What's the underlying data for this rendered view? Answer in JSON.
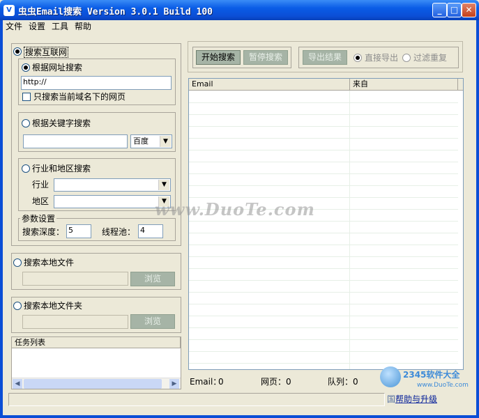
{
  "window": {
    "title": "虫虫Email搜索 Version 3.0.1 Build 100",
    "icon_label": "V",
    "minimize": "_",
    "maximize": "□",
    "close": "✕"
  },
  "menu": [
    "文件",
    "设置",
    "工具",
    "帮助"
  ],
  "search_internet": {
    "label": "搜索互联网",
    "by_url": {
      "label": "根据网址搜索",
      "url_value": "http://",
      "only_domain_label": "只搜索当前域名下的网页"
    },
    "by_keyword": {
      "label": "根据关键字搜索",
      "keyword_value": "",
      "engine": "百度"
    },
    "by_industry": {
      "label": "行业和地区搜索",
      "industry_label": "行业",
      "region_label": "地区"
    },
    "params": {
      "title": "参数设置",
      "depth_label": "搜索深度：",
      "depth_value": "5",
      "threads_label": "线程池：",
      "threads_value": "4"
    }
  },
  "local_file": {
    "label": "搜索本地文件",
    "browse": "浏览"
  },
  "local_folder": {
    "label": "搜索本地文件夹",
    "browse": "浏览"
  },
  "task_list": {
    "header": "任务列表"
  },
  "toolbar": {
    "start": "开始搜索",
    "pause": "暂停搜索",
    "export": "导出结果",
    "direct_export": "直接导出",
    "filter_dup": "过滤重复"
  },
  "results_table": {
    "columns": [
      "Email",
      "来自"
    ],
    "rows": []
  },
  "status": {
    "email_label": "Email：",
    "email_count": "0",
    "page_label": "网页：",
    "page_count": "0",
    "queue_label": "队列：",
    "queue_count": "0"
  },
  "help_link": "帮助与升级",
  "watermark": {
    "duote": "www.DuoTe.com",
    "site": "2345软件大全",
    "site_url": "www.DuoTe.com",
    "footer": "国产的软件站"
  }
}
